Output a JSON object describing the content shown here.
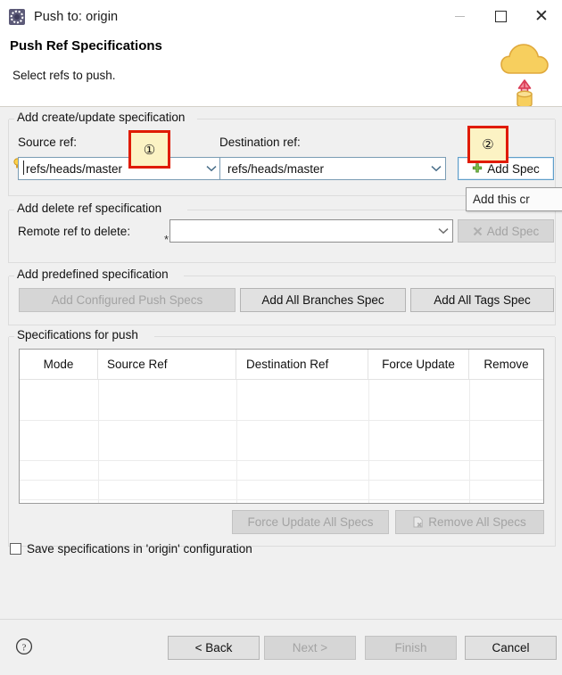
{
  "window": {
    "title": "Push to: origin",
    "icon": "git-push-icon",
    "controls": {
      "minimize": "minimize-icon",
      "maximize": "maximize-icon",
      "close": "close-icon"
    }
  },
  "banner": {
    "title": "Push Ref Specifications",
    "subtitle": "Select refs to push.",
    "icon": "cloud-upload-icon"
  },
  "create_update_group": {
    "legend": "Add create/update specification",
    "source_ref_label": "Source ref:",
    "source_ref_value": "refs/heads/master",
    "destination_ref_label": "Destination ref:",
    "destination_ref_value": "refs/heads/master",
    "add_spec_label": "Add Spec",
    "add_spec_icon": "green-plus-icon"
  },
  "delete_group": {
    "legend": "Add delete ref specification",
    "remote_ref_label": "Remote ref to delete:",
    "remote_ref_value": "",
    "required_marker": "*",
    "add_spec_label": "Add Spec",
    "add_spec_icon": "grey-x-icon"
  },
  "predefined_group": {
    "legend": "Add predefined specification",
    "buttons": [
      {
        "label": "Add Configured Push Specs",
        "enabled": false
      },
      {
        "label": "Add All Branches Spec",
        "enabled": true
      },
      {
        "label": "Add All Tags Spec",
        "enabled": true
      }
    ]
  },
  "specs_group": {
    "legend": "Specifications for push",
    "table": {
      "columns": [
        "Mode",
        "Source Ref",
        "Destination Ref",
        "Force Update",
        "Remove"
      ],
      "rows": []
    },
    "force_update_all_label": "Force Update All Specs",
    "remove_all_label": "Remove All Specs",
    "remove_all_icon": "remove-page-icon"
  },
  "save_checkbox": {
    "label": "Save specifications in 'origin' configuration",
    "checked": false
  },
  "tooltip": {
    "text": "Add this cr"
  },
  "callouts": [
    {
      "marker": "①"
    },
    {
      "marker": "②"
    }
  ],
  "footer": {
    "help_icon": "help-question-icon",
    "buttons": [
      {
        "label": "< Back",
        "enabled": true
      },
      {
        "label": "Next >",
        "enabled": false
      },
      {
        "label": "Finish",
        "enabled": false
      },
      {
        "label": "Cancel",
        "enabled": true
      }
    ]
  },
  "colors": {
    "callout_border": "#e01b00",
    "callout_fill": "#fcf3c4",
    "focus_blue": "#5f9ec9",
    "cloud_yellow": "#f5c842",
    "arrow_red": "#e0384f"
  }
}
